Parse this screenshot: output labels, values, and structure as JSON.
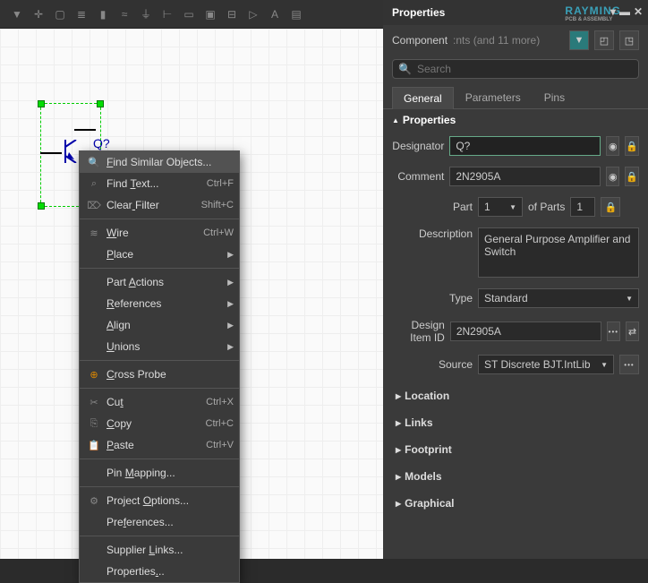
{
  "toolbar_icons": [
    "filter",
    "crosshair",
    "select-box",
    "align-left",
    "highlight",
    "wave",
    "ground",
    "dimension",
    "netlabel",
    "note",
    "dash",
    "port",
    "text",
    "sheet"
  ],
  "canvas": {
    "designator_text": "Q?"
  },
  "context_menu": [
    {
      "icon": "🔍",
      "label": "Find Similar Objects...",
      "u": 0,
      "shortcut": "",
      "sub": false,
      "selected": true
    },
    {
      "icon": "⌕",
      "label": "Find Text...",
      "u": 5,
      "shortcut": "Ctrl+F",
      "sub": false
    },
    {
      "icon": "⌦",
      "label": "Clear Filter",
      "u": 5,
      "shortcut": "Shift+C",
      "sub": false
    },
    {
      "sep": true
    },
    {
      "icon": "≋",
      "label": "Wire",
      "u": 0,
      "shortcut": "Ctrl+W",
      "sub": false
    },
    {
      "icon": "",
      "label": "Place",
      "u": 0,
      "sub": true
    },
    {
      "sep": true
    },
    {
      "icon": "",
      "label": "Part Actions",
      "u": 5,
      "sub": true
    },
    {
      "icon": "",
      "label": "References",
      "u": 0,
      "sub": true
    },
    {
      "icon": "",
      "label": "Align",
      "u": 0,
      "sub": true
    },
    {
      "icon": "",
      "label": "Unions",
      "u": 0,
      "sub": true
    },
    {
      "sep": true
    },
    {
      "icon": "⊕",
      "label": "Cross Probe",
      "u": 0,
      "sub": false,
      "iconColor": "#d80"
    },
    {
      "sep": true
    },
    {
      "icon": "✂",
      "label": "Cut",
      "u": 2,
      "shortcut": "Ctrl+X",
      "sub": false
    },
    {
      "icon": "⎘",
      "label": "Copy",
      "u": 0,
      "shortcut": "Ctrl+C",
      "sub": false
    },
    {
      "icon": "📋",
      "label": "Paste",
      "u": 0,
      "shortcut": "Ctrl+V",
      "sub": false
    },
    {
      "sep": true
    },
    {
      "icon": "",
      "label": "Pin Mapping...",
      "u": 4,
      "sub": false
    },
    {
      "sep": true
    },
    {
      "icon": "⚙",
      "label": "Project Options...",
      "u": 8,
      "sub": false
    },
    {
      "icon": "",
      "label": "Preferences...",
      "u": 3,
      "sub": false
    },
    {
      "sep": true
    },
    {
      "icon": "",
      "label": "Supplier Links...",
      "u": 9,
      "sub": false
    },
    {
      "icon": "",
      "label": "Properties...",
      "u": 10,
      "sub": false
    }
  ],
  "props": {
    "title": "Properties",
    "component_label": "Component",
    "component_hint": ":nts (and 11 more)",
    "search_placeholder": "Search",
    "tabs": [
      "General",
      "Parameters",
      "Pins"
    ],
    "active_tab": 0,
    "section_props": "Properties",
    "fields": {
      "designator_label": "Designator",
      "designator": "Q?",
      "comment_label": "Comment",
      "comment": "2N2905A",
      "part_label": "Part",
      "part": "1",
      "of_parts_label": "of Parts",
      "of_parts": "1",
      "description_label": "Description",
      "description": "General Purpose Amplifier and Switch",
      "type_label": "Type",
      "type": "Standard",
      "design_item_label": "Design Item ID",
      "design_item": "2N2905A",
      "source_label": "Source",
      "source": "ST Discrete BJT.IntLib"
    },
    "collapsed": [
      "Location",
      "Links",
      "Footprint",
      "Models",
      "Graphical"
    ]
  },
  "brand": {
    "name": "RAYMING",
    "sub": "PCB & ASSEMBLY"
  }
}
